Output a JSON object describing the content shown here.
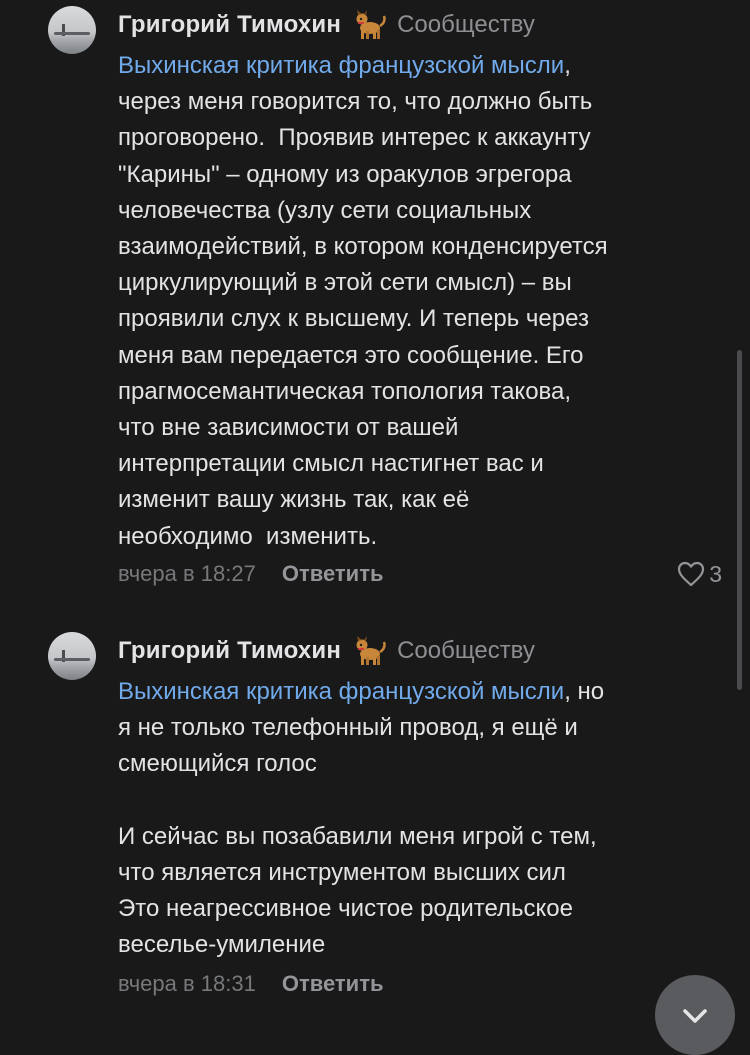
{
  "comments": [
    {
      "author": "Григорий Тимохин",
      "community": "Сообществу",
      "mention": "Выхинская критика французской мысли",
      "text": ",\nчерез меня говорится то, что должно быть\nпроговорено.  Проявив интерес к аккаунту\n\"Карины\" – одному из оракулов эгрегора\nчеловечества (узлу сети социальных\nвзаимодействий, в котором конденсируется\nциркулирующий в этой сети смысл) – вы\nпроявили слух к высшему. И теперь через\nменя вам передается это сообщение. Его\nпрагмосемантическая топология такова,\nчто вне зависимости от вашей\nинтерпретации смысл настигнет вас и\nизменит вашу жизнь так, как её\nнеобходимо  изменить.",
      "time": "вчера в 18:27",
      "reply_label": "Ответить",
      "likes": "3"
    },
    {
      "author": "Григорий Тимохин",
      "community": "Сообществу",
      "mention": "Выхинская критика французской мысли",
      "text": ", но\nя не только телефонный провод, я ещё и\nсмеющийся голос\n\nИ сейчас вы позабавили меня игрой с тем,\nчто является инструментом высших сил\nЭто неагрессивное чистое родительское\nвеселье-умиление",
      "time": "вчера в 18:31",
      "reply_label": "Ответить"
    }
  ],
  "icons": {
    "badge": "dog-emoji-icon",
    "like": "heart-icon",
    "scroll": "chevron-down-icon"
  },
  "colors": {
    "background": "#19191a",
    "text": "#e3e3e5",
    "link": "#71aaeb",
    "secondary": "#8e8e93"
  }
}
